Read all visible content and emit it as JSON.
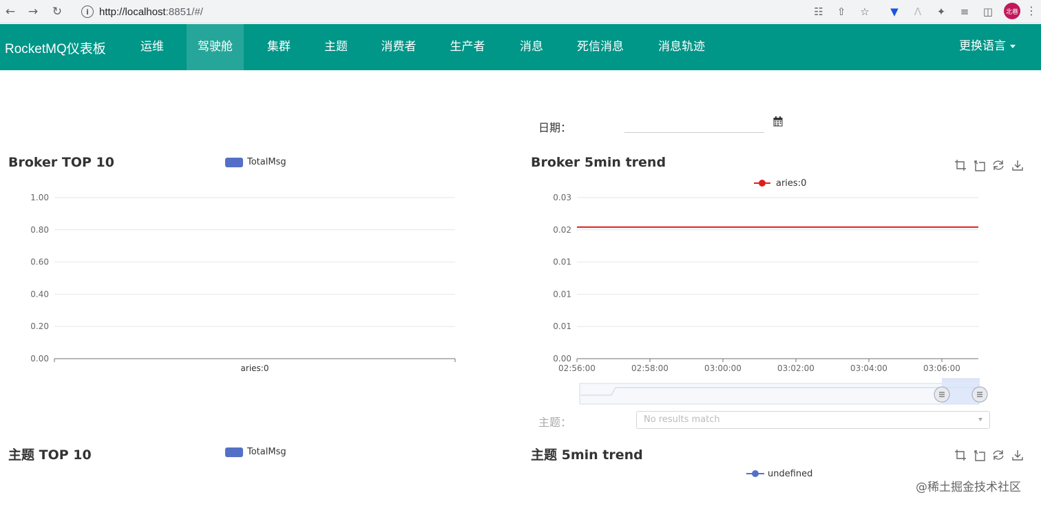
{
  "browser": {
    "url_host": "http://localhost",
    "url_rest": ":8851/#/",
    "profile_label": "北巷"
  },
  "navbar": {
    "brand": "RocketMQ仪表板",
    "items": [
      {
        "label": "运维"
      },
      {
        "label": "驾驶舱"
      },
      {
        "label": "集群"
      },
      {
        "label": "主题"
      },
      {
        "label": "消费者"
      },
      {
        "label": "生产者"
      },
      {
        "label": "消息"
      },
      {
        "label": "死信消息"
      },
      {
        "label": "消息轨迹"
      }
    ],
    "active_index": 1,
    "language": "更换语言"
  },
  "filters": {
    "date_label": "日期：",
    "date_value": "",
    "topic_label": "主题：",
    "topic_placeholder": "No results match"
  },
  "colors": {
    "navbar": "#009688",
    "active_tab": "#26a69a",
    "bar_series": "#5470c6",
    "trend_line": "#e01e1e"
  },
  "sections": {
    "broker_top": "Broker TOP 10",
    "broker_trend": "Broker 5min trend",
    "topic_top": "主题 TOP 10",
    "topic_trend": "主题 5min trend"
  },
  "chart_data": [
    {
      "type": "bar",
      "title": "Broker TOP 10",
      "legend": [
        "TotalMsg"
      ],
      "categories": [
        "aries:0"
      ],
      "series": [
        {
          "name": "TotalMsg",
          "values": [
            0
          ]
        }
      ],
      "yticks": [
        "0.00",
        "0.20",
        "0.40",
        "0.60",
        "0.80",
        "1.00"
      ],
      "ylim": [
        0,
        1
      ]
    },
    {
      "type": "line",
      "title": "Broker 5min trend",
      "legend": [
        "aries:0"
      ],
      "x": [
        "02:56:00",
        "02:58:00",
        "03:00:00",
        "03:02:00",
        "03:04:00",
        "03:06:00"
      ],
      "series": [
        {
          "name": "aries:0",
          "values": [
            0.0245,
            0.0245,
            0.0245,
            0.0245,
            0.0245,
            0.0245
          ]
        }
      ],
      "yticks": [
        "0.00",
        "0.01",
        "0.01",
        "0.01",
        "0.02",
        "0.03"
      ],
      "ylim": [
        0,
        0.03
      ],
      "legend_position": "top-center"
    },
    {
      "type": "bar",
      "title": "主题 TOP 10",
      "legend": [
        "TotalMsg"
      ],
      "categories": [],
      "series": [
        {
          "name": "TotalMsg",
          "values": []
        }
      ]
    },
    {
      "type": "line",
      "title": "主题 5min trend",
      "legend": [
        "undefined"
      ],
      "series": [
        {
          "name": "undefined",
          "values": []
        }
      ]
    }
  ],
  "watermark": "@稀土掘金技术社区"
}
